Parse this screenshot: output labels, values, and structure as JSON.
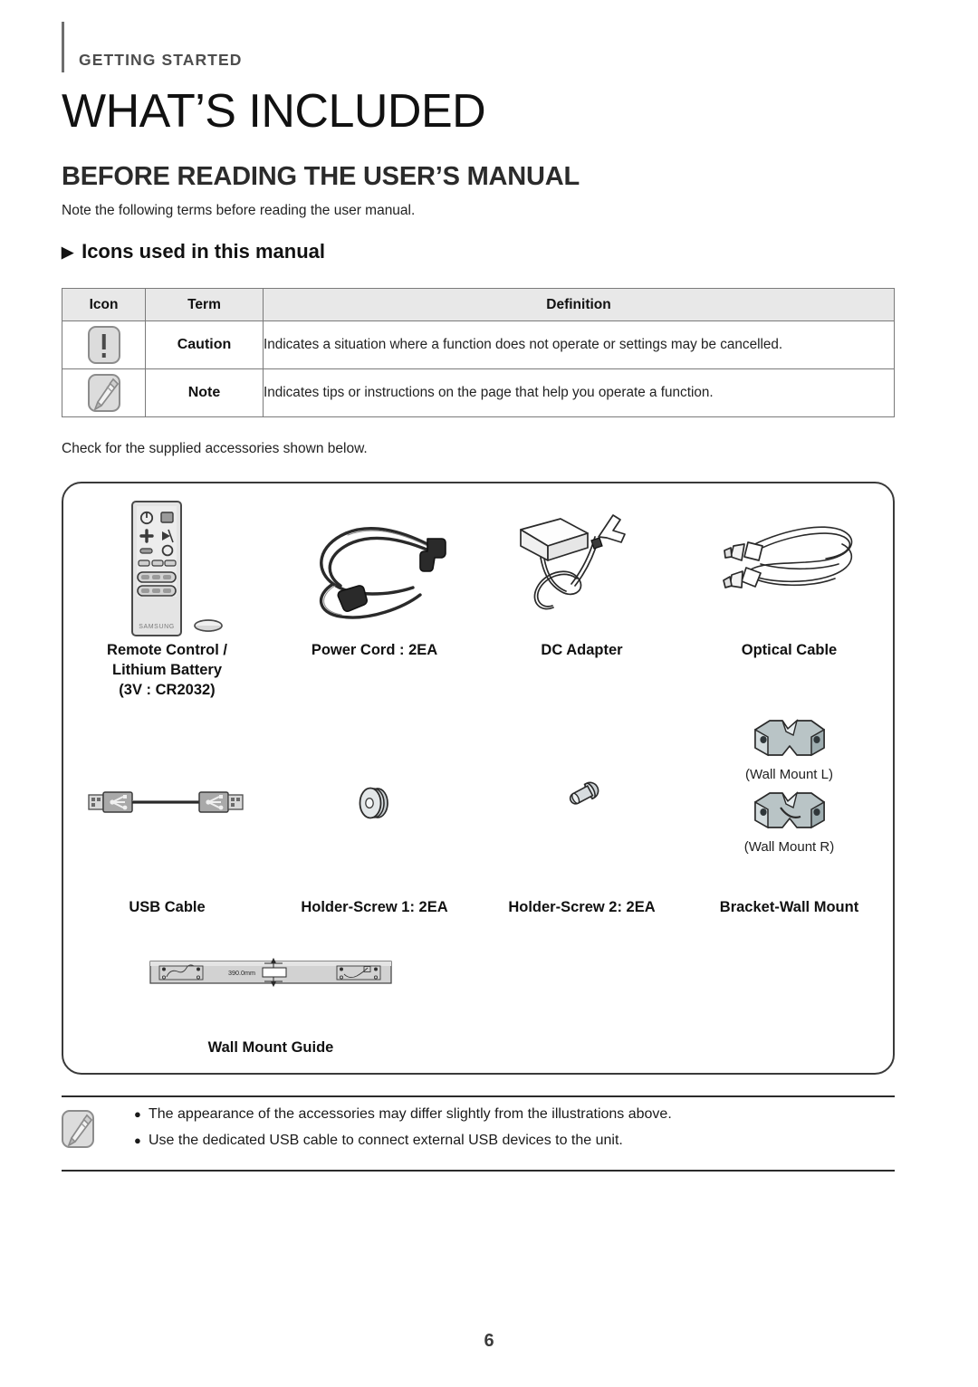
{
  "header": {
    "eyebrow": "GETTING STARTED",
    "chapter_title": "WHAT’S INCLUDED",
    "section_title": "BEFORE READING THE USER’S MANUAL",
    "intro": "Note the following terms before reading the user manual.",
    "subsection_marker": "▶",
    "subsection_title": "Icons used in this manual"
  },
  "legend_table": {
    "columns": [
      "Icon",
      "Term",
      "Definition"
    ],
    "rows": [
      {
        "icon": "caution-icon",
        "term": "Caution",
        "definition": "Indicates a situation where a function does not operate or settings may be cancelled."
      },
      {
        "icon": "note-icon",
        "term": "Note",
        "definition": "Indicates tips or instructions on the page that help you operate a function."
      }
    ]
  },
  "accessories": {
    "intro": "Check for the supplied accessories shown below.",
    "row1": [
      {
        "art": "remote-control-and-battery",
        "label": "Remote Control /\nLithium Battery\n(3V : CR2032)"
      },
      {
        "art": "power-cord",
        "label": "Power Cord : 2EA"
      },
      {
        "art": "dc-adapter",
        "label": "DC Adapter"
      },
      {
        "art": "optical-cable",
        "label": "Optical Cable"
      }
    ],
    "row2": [
      {
        "art": "usb-cable",
        "label": "USB Cable"
      },
      {
        "art": "holder-screw-1",
        "label": "Holder-Screw 1: 2EA"
      },
      {
        "art": "holder-screw-2",
        "label": "Holder-Screw 2: 2EA"
      },
      {
        "art": "bracket-wall-mount",
        "label": "Bracket-Wall Mount",
        "sub_label_l": "(Wall Mount L)",
        "sub_label_r": "(Wall Mount R)"
      }
    ],
    "row3": [
      {
        "art": "wall-mount-guide",
        "label": "Wall Mount Guide",
        "dimension": "390.0mm"
      }
    ]
  },
  "notes": {
    "icon": "note-icon",
    "bullet": "●",
    "items": [
      "The appearance of the accessories may differ slightly from the illustrations above.",
      "Use the dedicated USB cable to connect external USB devices to the unit."
    ]
  },
  "footer": {
    "page_number": "6"
  },
  "colors": {
    "rule": "#6e6e6e",
    "table_header_bg": "#e8e8e8",
    "table_border": "#7a7a7a",
    "panel_border": "#3a3a3a",
    "metal": "#b9c4c6",
    "text": "#1a1a1a"
  }
}
